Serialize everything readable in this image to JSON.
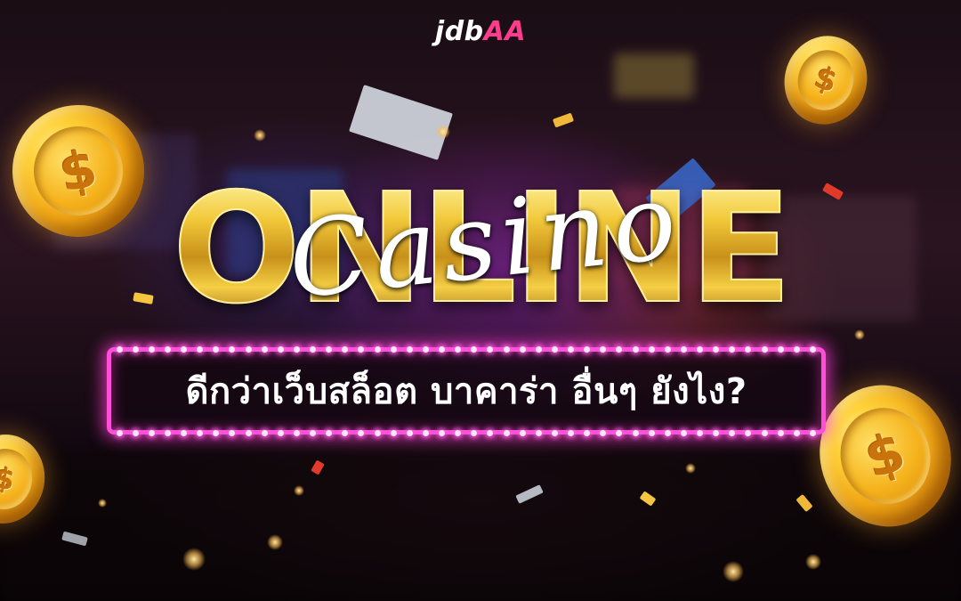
{
  "logo": {
    "main": "jdb",
    "accent": "AA"
  },
  "headline": {
    "main_word": "ONLINE",
    "script_word": "Casino"
  },
  "marquee": {
    "text": "ดีกว่าเว็บสล็อต บาคาร่า อื่นๆ ยังไง?"
  },
  "icons": {
    "coin": "dollar-coin-icon",
    "coin_symbol": "$"
  },
  "colors": {
    "gold": "#f2c93a",
    "neon_pink": "#ff4fd8",
    "logo_accent": "#ff3c8c",
    "background": "#1a0d14"
  }
}
